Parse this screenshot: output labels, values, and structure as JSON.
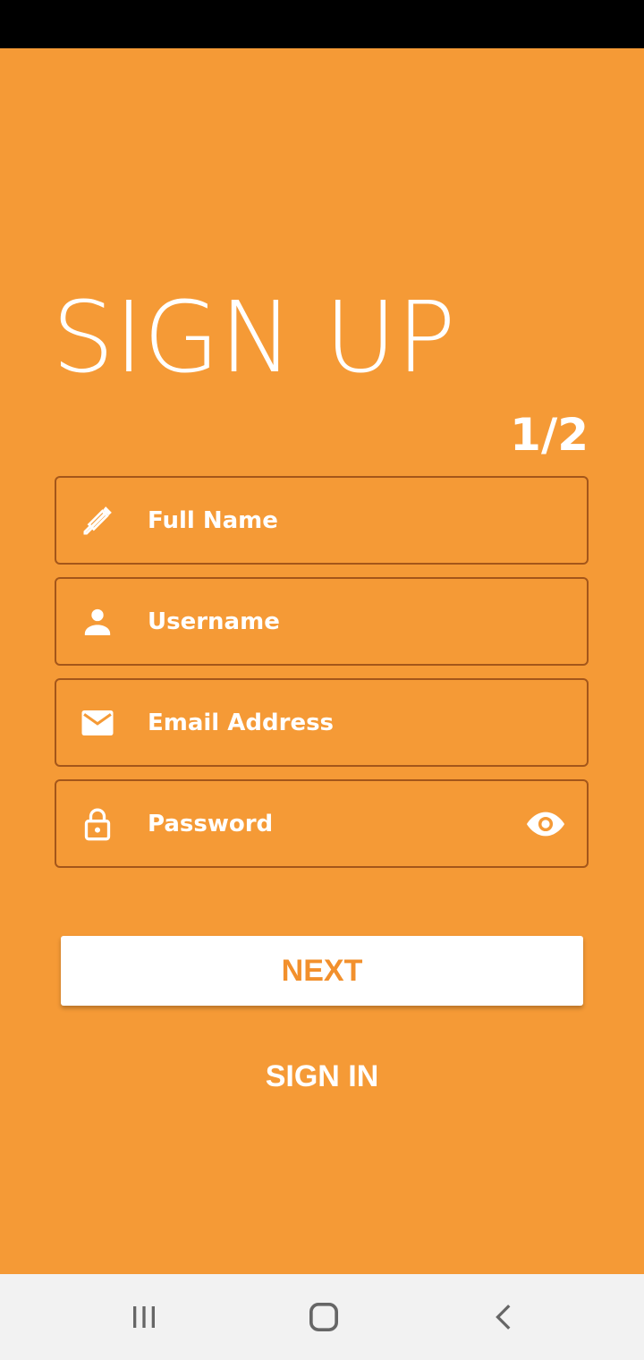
{
  "header": {
    "title": "SIGN UP",
    "step": "1/2"
  },
  "form": {
    "fields": [
      {
        "label": "Full Name",
        "icon": "pen-icon"
      },
      {
        "label": "Username",
        "icon": "person-icon"
      },
      {
        "label": "Email Address",
        "icon": "mail-icon"
      },
      {
        "label": "Password",
        "icon": "lock-icon",
        "trailing_icon": "eye-icon"
      }
    ]
  },
  "actions": {
    "next_label": "NEXT",
    "signin_label": "SIGN IN"
  },
  "navbar": {
    "icons": [
      "recent-apps-icon",
      "home-icon",
      "back-icon"
    ]
  },
  "colors": {
    "background": "#f59a36",
    "accent_text": "#f2902c",
    "field_border": "#a4561a",
    "navbar": "#f2f2f2"
  }
}
